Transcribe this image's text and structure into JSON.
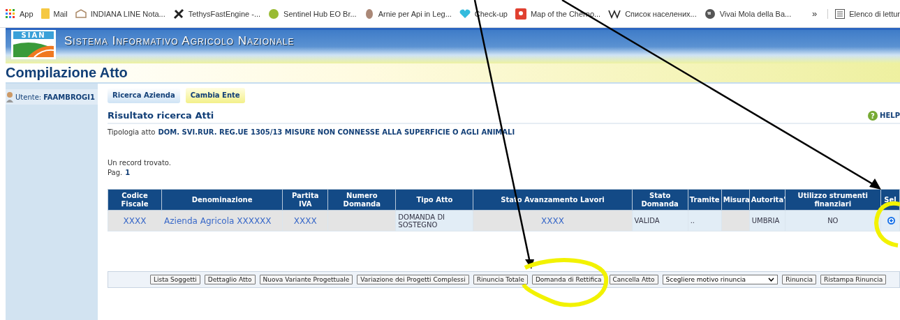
{
  "bookmarks": [
    {
      "label": "App",
      "kind": "apps"
    },
    {
      "label": "Mail",
      "kind": "folder"
    },
    {
      "label": "INDIANA LINE Nota...",
      "kind": "building"
    },
    {
      "label": "TethysFastEngine -...",
      "kind": "satellite"
    },
    {
      "label": "Sentinel Hub EO Br...",
      "kind": "ball"
    },
    {
      "label": "Arnie per Api in Leg...",
      "kind": "bee"
    },
    {
      "label": "Check-up",
      "kind": "heart"
    },
    {
      "label": "Map of the Cherno...",
      "kind": "pin"
    },
    {
      "label": "Список населених...",
      "kind": "wiki"
    },
    {
      "label": "Vivai Mola della Ba...",
      "kind": "globe"
    }
  ],
  "bookmarks_more": "»",
  "reading_list": "Elenco di lettur",
  "banner": {
    "logo": "SIAN",
    "title": "Sistema Informativo Agricolo Nazionale"
  },
  "page_title": "Compilazione Atto",
  "user": {
    "label": "Utente:",
    "value": "FAAMBROGI1"
  },
  "nav_buttons": [
    {
      "label": "Ricerca Azienda",
      "kind": "blue"
    },
    {
      "label": "Cambia Ente",
      "kind": "yellow"
    }
  ],
  "section_title": "Risultato ricerca Atti",
  "help": "HELP",
  "help_icon": "?",
  "tipologia": {
    "label": "Tipologia atto",
    "value": "DOM. SVI.RUR. REG.UE 1305/13 MISURE NON CONNESSE ALLA SUPERFICIE O AGLI ANIMALI"
  },
  "record_count": "Un record trovato.",
  "page": {
    "label": "Pag.",
    "value": "1"
  },
  "table": {
    "columns": [
      "Codice Fiscale",
      "Denominazione",
      "Partita IVA",
      "Numero Domanda",
      "Tipo Atto",
      "Stato Avanzamento Lavori",
      "Stato Domanda",
      "Tramite",
      "Misura",
      "Autorita'",
      "Utilizzo strumenti finanziari",
      "Sel"
    ],
    "rows": [
      {
        "cells": [
          "XXXX",
          "Azienda Agricola XXXXXX",
          "XXXX",
          "",
          "DOMANDA DI SOSTEGNO",
          "XXXX",
          "VALIDA",
          "..",
          "",
          "UMBRIA",
          "NO"
        ],
        "selected": true
      }
    ]
  },
  "actions": [
    "Lista Soggetti",
    "Dettaglio Atto",
    "Nuova Variante Progettuale",
    "Variazione dei Progetti Complessi",
    "Rinuncia Totale",
    "Domanda di Rettifica",
    "Cancella Atto"
  ],
  "reason_select": {
    "value": "Scegliere motivo rinuncia"
  },
  "actions_after": [
    "Rinuncia",
    "Ristampa Rinuncia"
  ]
}
